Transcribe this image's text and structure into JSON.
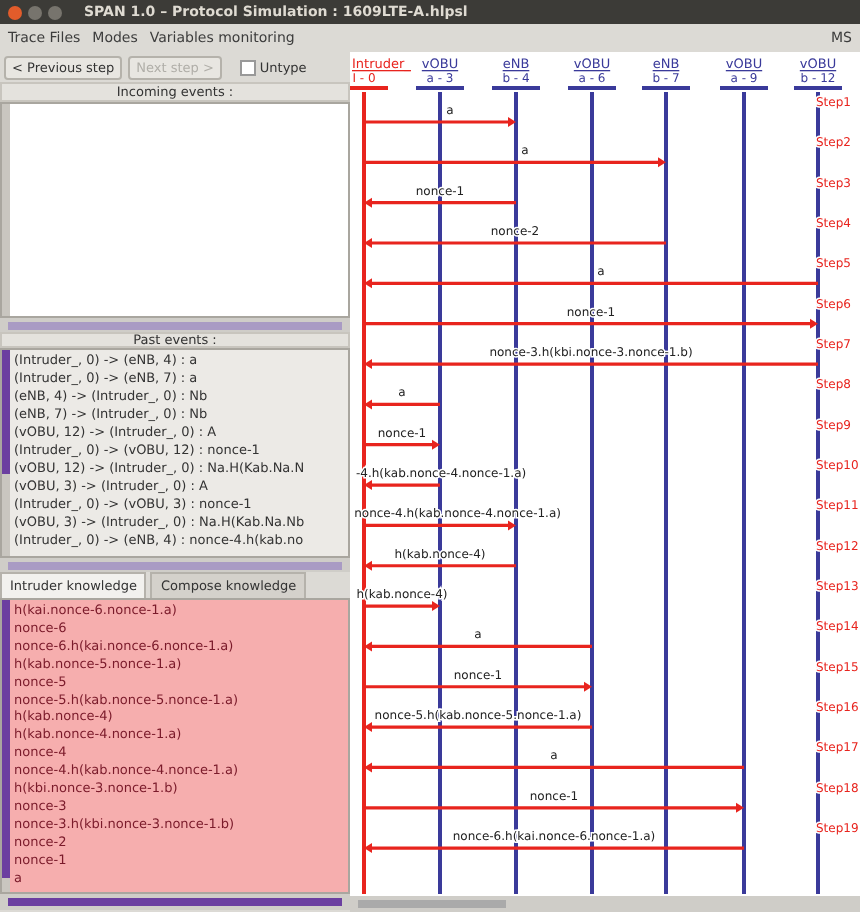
{
  "window": {
    "title": "SPAN 1.0 – Protocol Simulation : 1609LTE-A.hlpsl"
  },
  "menu": [
    {
      "label": "Trace Files"
    },
    {
      "label": "Modes"
    },
    {
      "label": "Variables monitoring"
    }
  ],
  "menu_right": "MS",
  "toolbar": {
    "previous": {
      "label": "< Previous step",
      "disabled": false
    },
    "next": {
      "label": "Next step >",
      "disabled": true
    },
    "untype": {
      "label": "Untype",
      "checked": false
    }
  },
  "incoming_events": {
    "title": "Incoming events :"
  },
  "past_events": {
    "title": "Past events :",
    "items": [
      "(Intruder_, 0) -> (eNB, 4) : a",
      "(Intruder_, 0) -> (eNB, 7) : a",
      "(eNB, 4) -> (Intruder_, 0) : Nb",
      "(eNB, 7) -> (Intruder_, 0) : Nb",
      "(vOBU, 12) -> (Intruder_, 0) : A",
      "(Intruder_, 0) -> (vOBU, 12) : nonce-1",
      "(vOBU, 12) -> (Intruder_, 0) : Na.H(Kab.Na.N",
      "(vOBU, 3) -> (Intruder_, 0) : A",
      "(Intruder_, 0) -> (vOBU, 3) : nonce-1",
      "(vOBU, 3) -> (Intruder_, 0) : Na.H(Kab.Na.Nb",
      "(Intruder_, 0) -> (eNB, 4) : nonce-4.h(kab.no"
    ]
  },
  "tabs": [
    {
      "label": "Intruder knowledge",
      "selected": true
    },
    {
      "label": "Compose knowledge",
      "selected": false
    }
  ],
  "knowledge": [
    "h(kai.nonce-6.nonce-1.a)",
    "nonce-6",
    "nonce-6.h(kai.nonce-6.nonce-1.a)",
    "h(kab.nonce-5.nonce-1.a)",
    "nonce-5",
    "nonce-5.h(kab.nonce-5.nonce-1.a)",
    "h(kab.nonce-4)",
    "h(kab.nonce-4.nonce-1.a)",
    "nonce-4",
    "nonce-4.h(kab.nonce-4.nonce-1.a)",
    "h(kbi.nonce-3.nonce-1.b)",
    "nonce-3",
    "nonce-3.h(kbi.nonce-3.nonce-1.b)",
    "nonce-2",
    "nonce-1",
    "a"
  ],
  "lifelines": [
    {
      "name": "Intruder_",
      "id": "I - 0",
      "kind": "intruder"
    },
    {
      "name": "vOBU",
      "id": "a - 3",
      "kind": "agent"
    },
    {
      "name": "eNB",
      "id": "b - 4",
      "kind": "agent"
    },
    {
      "name": "vOBU",
      "id": "a - 6",
      "kind": "agent"
    },
    {
      "name": "eNB",
      "id": "b - 7",
      "kind": "agent"
    },
    {
      "name": "vOBU",
      "id": "a - 9",
      "kind": "agent"
    },
    {
      "name": "vOBU",
      "id": "b - 12",
      "kind": "agent"
    }
  ],
  "messages": [
    {
      "step": "Step1",
      "label": "a"
    },
    {
      "step": "Step2",
      "label": "a"
    },
    {
      "step": "Step3",
      "label": "nonce-1"
    },
    {
      "step": "Step4",
      "label": "nonce-2"
    },
    {
      "step": "Step5",
      "label": "a"
    },
    {
      "step": "Step6",
      "label": "nonce-1"
    },
    {
      "step": "Step7",
      "label": "nonce-3.h(kbi.nonce-3.nonce-1.b)"
    },
    {
      "step": "Step8",
      "label": "a"
    },
    {
      "step": "Step9",
      "label": "nonce-1"
    },
    {
      "step": "Step10",
      "label": "-4.h(kab.nonce-4.nonce-1.a)"
    },
    {
      "step": "Step11",
      "label": "nonce-4.h(kab.nonce-4.nonce-1.a)"
    },
    {
      "step": "Step12",
      "label": "h(kab.nonce-4)"
    },
    {
      "step": "Step13",
      "label": "h(kab.nonce-4)"
    },
    {
      "step": "Step14",
      "label": "a"
    },
    {
      "step": "Step15",
      "label": "nonce-1"
    },
    {
      "step": "Step16",
      "label": "nonce-5.h(kab.nonce-5.nonce-1.a)"
    },
    {
      "step": "Step17",
      "label": "a"
    },
    {
      "step": "Step18",
      "label": "nonce-1"
    },
    {
      "step": "Step19",
      "label": "nonce-6.h(kai.nonce-6.nonce-1.a)"
    }
  ]
}
